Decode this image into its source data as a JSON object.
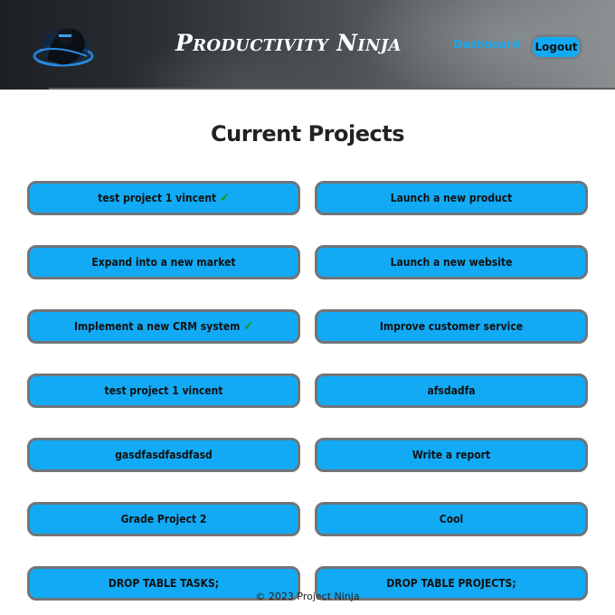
{
  "header": {
    "brand": "Productivity Ninja",
    "nav": {
      "dashboard": "Dashboard",
      "logout": "Logout"
    },
    "logo_icon": "ninja-logo-icon"
  },
  "main": {
    "title": "Current Projects",
    "projects": [
      {
        "label": "test project 1 vincent",
        "completed": true
      },
      {
        "label": "Launch a new product",
        "completed": false
      },
      {
        "label": "Expand into a new market",
        "completed": false
      },
      {
        "label": "Launch a new website",
        "completed": false
      },
      {
        "label": "Implement a new CRM system",
        "completed": true
      },
      {
        "label": "Improve customer service",
        "completed": false
      },
      {
        "label": "test project 1 vincent",
        "completed": false
      },
      {
        "label": "afsdadfa",
        "completed": false
      },
      {
        "label": "gasdfasdfasdfasd",
        "completed": false
      },
      {
        "label": "Write a report",
        "completed": false
      },
      {
        "label": "Grade Project 2",
        "completed": false
      },
      {
        "label": "Cool",
        "completed": false
      },
      {
        "label": "DROP TABLE TASKS;",
        "completed": false
      },
      {
        "label": "DROP TABLE PROJECTS;",
        "completed": false
      }
    ],
    "check_glyph": "✔"
  },
  "footer": {
    "text": "© 2023 Project Ninja"
  },
  "colors": {
    "accent": "#12aaf5",
    "check": "#1a9a2a",
    "nav_link": "#18a8f0",
    "border": "#707579"
  }
}
